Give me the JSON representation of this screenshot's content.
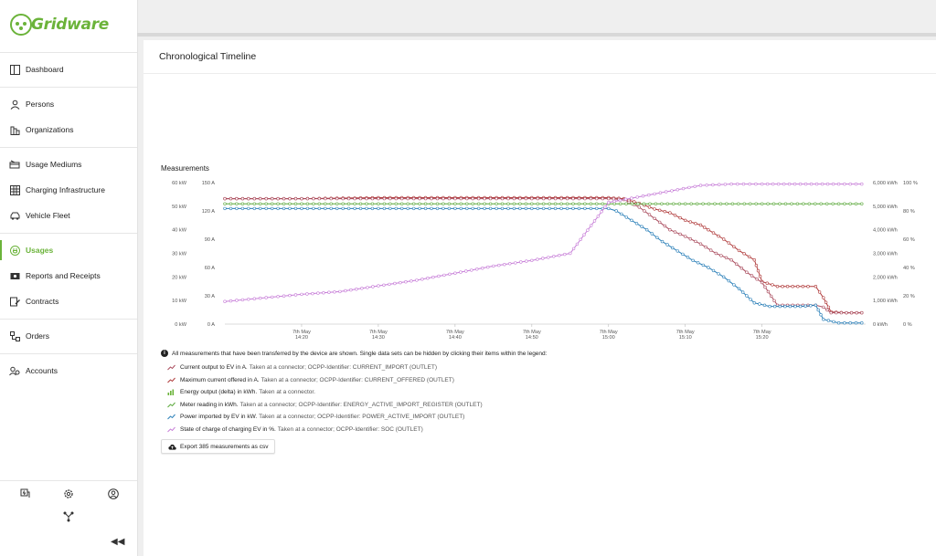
{
  "brand": {
    "name": "Gridware",
    "color": "#6bb33a"
  },
  "nav": {
    "items": [
      {
        "label": "Dashboard",
        "icon": "dashboard-icon"
      },
      {
        "label": "Persons",
        "icon": "person-icon"
      },
      {
        "label": "Organizations",
        "icon": "building-icon"
      },
      {
        "label": "Usage Mediums",
        "icon": "card-icon"
      },
      {
        "label": "Charging Infrastructure",
        "icon": "grid-icon"
      },
      {
        "label": "Vehicle Fleet",
        "icon": "car-icon"
      },
      {
        "label": "Usages",
        "icon": "plug-icon",
        "active": true
      },
      {
        "label": "Reports and Receipts",
        "icon": "receipt-icon"
      },
      {
        "label": "Contracts",
        "icon": "contract-icon"
      },
      {
        "label": "Orders",
        "icon": "orders-icon"
      },
      {
        "label": "Accounts",
        "icon": "accounts-icon"
      }
    ],
    "bottom_icons": [
      "charger-icon",
      "gear-icon",
      "user-circle-icon",
      "network-icon"
    ],
    "collapse_label": "◀◀"
  },
  "page": {
    "title": "Chronological Timeline"
  },
  "measurements": {
    "title": "Measurements",
    "info_text": "All measurements that have been transferred by the device are shown. Single data sets can be hidden by clicking their items within the legend:",
    "legend": [
      {
        "label": "Current output to EV in A.",
        "detail": "Taken at a connector; OCPP-Identifier: CURRENT_IMPORT (OUTLET)",
        "color": "#a94a5c",
        "icon": "line-chart-icon"
      },
      {
        "label": "Maximum current offered in A.",
        "detail": "Taken at a connector; OCPP-Identifier: CURRENT_OFFERED (OUTLET)",
        "color": "#b03a3a",
        "icon": "line-chart-icon"
      },
      {
        "label": "Energy output (delta) in kWh.",
        "detail": "Taken at a connector.",
        "color": "#6bb33a",
        "icon": "bar-chart-icon"
      },
      {
        "label": "Meter reading in kWh.",
        "detail": "Taken at a connector; OCPP-Identifier: ENERGY_ACTIVE_IMPORT_REGISTER (OUTLET)",
        "color": "#5aa83a",
        "icon": "line-chart-icon"
      },
      {
        "label": "Power imported by EV in kW.",
        "detail": "Taken at a connector; OCPP-Identifier: POWER_ACTIVE_IMPORT (OUTLET)",
        "color": "#2a7fb8",
        "icon": "line-chart-icon"
      },
      {
        "label": "State of charge of charging EV in %.",
        "detail": "Taken at a connector; OCPP-Identifier: SOC (OUTLET)",
        "color": "#c77ed8",
        "icon": "line-chart-icon"
      }
    ],
    "export_label": "Export 385 measurements as csv"
  },
  "chart_data": {
    "type": "line",
    "axes": {
      "kw": {
        "ticks": [
          "0 kW",
          "10 kW",
          "20 kW",
          "30 kW",
          "40 kW",
          "50 kW",
          "60 kW"
        ]
      },
      "amps": {
        "ticks": [
          "0 A",
          "30 A",
          "60 A",
          "90 A",
          "120 A",
          "150 A"
        ]
      },
      "kwh": {
        "ticks": [
          "0 kWh",
          "1,000 kWh",
          "2,000 kWh",
          "3,000 kWh",
          "4,000 kWh",
          "5,000 kWh",
          "6,000 kWh"
        ]
      },
      "pct": {
        "ticks": [
          "0 %",
          "20 %",
          "40 %",
          "60 %",
          "80 %",
          "100 %"
        ]
      }
    },
    "x_ticks": [
      {
        "line1": "7th May",
        "line2": "14:20"
      },
      {
        "line1": "7th May",
        "line2": "14:30"
      },
      {
        "line1": "7th May",
        "line2": "14:40"
      },
      {
        "line1": "7th May",
        "line2": "14:50"
      },
      {
        "line1": "7th May",
        "line2": "15:00"
      },
      {
        "line1": "7th May",
        "line2": "15:10"
      },
      {
        "line1": "7th May",
        "line2": "15:20"
      }
    ],
    "x_minutes_range": [
      -10,
      73.5
    ],
    "tick_minutes": [
      0,
      10,
      20,
      30,
      40,
      50,
      60
    ],
    "series": [
      {
        "name": "Maximum current offered",
        "axis": "amps",
        "color": "#b03a3a",
        "points": [
          [
            -10,
            133
          ],
          [
            0,
            133
          ],
          [
            10,
            134
          ],
          [
            20,
            134
          ],
          [
            30,
            134
          ],
          [
            40,
            134
          ],
          [
            42,
            133
          ],
          [
            44,
            128
          ],
          [
            46,
            122
          ],
          [
            48,
            118
          ],
          [
            50,
            110
          ],
          [
            52,
            105
          ],
          [
            53,
            100
          ],
          [
            55,
            90
          ],
          [
            57,
            78
          ],
          [
            59,
            68
          ],
          [
            60,
            45
          ],
          [
            62,
            40
          ],
          [
            64,
            40
          ],
          [
            66,
            40
          ],
          [
            67,
            40
          ],
          [
            68,
            28
          ],
          [
            69,
            13
          ],
          [
            71,
            12
          ],
          [
            73,
            12
          ]
        ]
      },
      {
        "name": "Current output to EV",
        "axis": "amps",
        "color": "#a94a5c",
        "points": [
          [
            -10,
            133
          ],
          [
            0,
            133
          ],
          [
            10,
            133
          ],
          [
            20,
            133
          ],
          [
            30,
            133
          ],
          [
            40,
            133
          ],
          [
            42,
            132
          ],
          [
            44,
            124
          ],
          [
            46,
            112
          ],
          [
            48,
            100
          ],
          [
            50,
            93
          ],
          [
            52,
            85
          ],
          [
            54,
            75
          ],
          [
            56,
            68
          ],
          [
            58,
            55
          ],
          [
            60,
            44
          ],
          [
            62,
            20
          ],
          [
            64,
            20
          ],
          [
            66,
            20
          ],
          [
            67,
            20
          ],
          [
            68,
            18
          ],
          [
            69,
            12
          ],
          [
            71,
            12
          ],
          [
            73,
            12
          ]
        ]
      },
      {
        "name": "Meter reading",
        "axis": "kwh",
        "color": "#5aa83a",
        "points": [
          [
            -10,
            5100
          ],
          [
            0,
            5100
          ],
          [
            10,
            5100
          ],
          [
            20,
            5100
          ],
          [
            30,
            5100
          ],
          [
            40,
            5100
          ],
          [
            50,
            5100
          ],
          [
            60,
            5100
          ],
          [
            70,
            5100
          ],
          [
            73,
            5100
          ]
        ]
      },
      {
        "name": "Power imported by EV",
        "axis": "kw",
        "color": "#2a7fb8",
        "points": [
          [
            -10,
            49
          ],
          [
            0,
            49
          ],
          [
            10,
            49
          ],
          [
            20,
            49
          ],
          [
            30,
            49
          ],
          [
            40,
            49
          ],
          [
            41,
            48
          ],
          [
            43,
            44
          ],
          [
            45,
            40
          ],
          [
            47,
            35
          ],
          [
            49,
            31
          ],
          [
            51,
            27
          ],
          [
            53,
            24
          ],
          [
            55,
            20
          ],
          [
            57,
            15
          ],
          [
            59,
            9
          ],
          [
            61,
            7.5
          ],
          [
            63,
            7.5
          ],
          [
            65,
            7.5
          ],
          [
            67,
            8
          ],
          [
            68,
            2
          ],
          [
            70,
            0.5
          ],
          [
            73,
            0.5
          ]
        ]
      },
      {
        "name": "State of charge",
        "axis": "pct",
        "color": "#c77ed8",
        "points": [
          [
            -10,
            16
          ],
          [
            0,
            21
          ],
          [
            5,
            23
          ],
          [
            10,
            27
          ],
          [
            15,
            31
          ],
          [
            20,
            36
          ],
          [
            25,
            41
          ],
          [
            30,
            45
          ],
          [
            35,
            50
          ],
          [
            40,
            86
          ],
          [
            43,
            89
          ],
          [
            46,
            92
          ],
          [
            49,
            95
          ],
          [
            52,
            98
          ],
          [
            56,
            99
          ],
          [
            60,
            99
          ],
          [
            65,
            99
          ],
          [
            70,
            99
          ],
          [
            73,
            99
          ]
        ]
      }
    ]
  }
}
